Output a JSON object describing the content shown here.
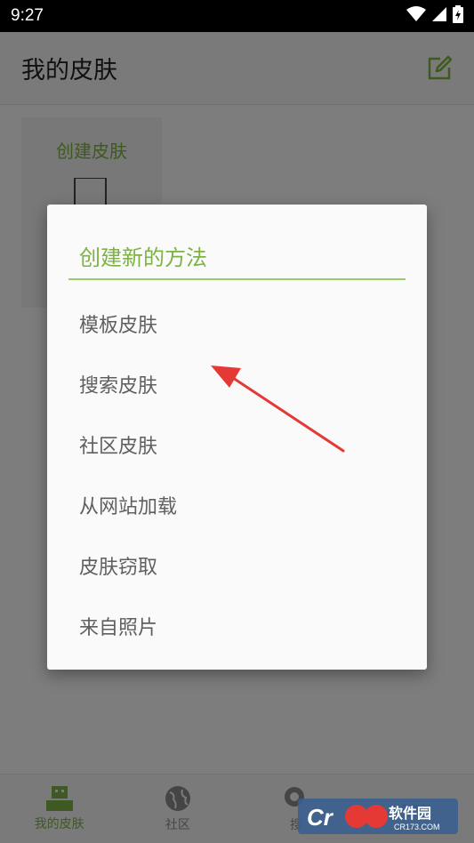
{
  "status_bar": {
    "time": "9:27"
  },
  "app_bar": {
    "title": "我的皮肤"
  },
  "skin_card": {
    "label": "创建皮肤"
  },
  "bottom_nav": {
    "items": [
      {
        "label": "我的皮肤"
      },
      {
        "label": "社区"
      },
      {
        "label": "搜"
      },
      {
        "label": ""
      }
    ]
  },
  "dialog": {
    "title": "创建新的方法",
    "options": [
      "模板皮肤",
      "搜索皮肤",
      "社区皮肤",
      "从网站加载",
      "皮肤窃取",
      "来自照片"
    ]
  },
  "watermark": {
    "text": "软件园",
    "site": "CR173.COM"
  },
  "colors": {
    "accent": "#7cb342",
    "arrow": "#e53935"
  }
}
